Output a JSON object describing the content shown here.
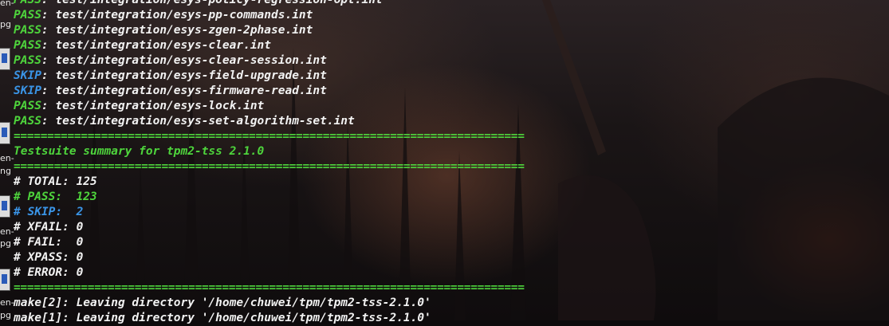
{
  "desktop": {
    "labels": [
      "en-",
      "pg",
      "en-",
      "ng",
      "en-",
      "pg",
      "en-",
      "pg"
    ]
  },
  "terminal": {
    "lines": [
      {
        "status": "PASS",
        "status_color": "green",
        "text": ": test/integration/esys-policy-regression-opt.int"
      },
      {
        "status": "PASS",
        "status_color": "green",
        "text": ": test/integration/esys-pp-commands.int"
      },
      {
        "status": "PASS",
        "status_color": "green",
        "text": ": test/integration/esys-zgen-2phase.int"
      },
      {
        "status": "PASS",
        "status_color": "green",
        "text": ": test/integration/esys-clear.int"
      },
      {
        "status": "PASS",
        "status_color": "green",
        "text": ": test/integration/esys-clear-session.int"
      },
      {
        "status": "SKIP",
        "status_color": "blue",
        "text": ": test/integration/esys-field-upgrade.int"
      },
      {
        "status": "SKIP",
        "status_color": "blue",
        "text": ": test/integration/esys-firmware-read.int"
      },
      {
        "status": "PASS",
        "status_color": "green",
        "text": ": test/integration/esys-lock.int"
      },
      {
        "status": "PASS",
        "status_color": "green",
        "text": ": test/integration/esys-set-algorithm-set.int"
      }
    ],
    "separator": "============================================================================",
    "summary_title": "Testsuite summary for tpm2-tss 2.1.0",
    "totals": [
      {
        "text": "# TOTAL: 125",
        "color": "white"
      },
      {
        "text": "# PASS:  123",
        "color": "green"
      },
      {
        "text": "# SKIP:  2",
        "color": "blue"
      },
      {
        "text": "# XFAIL: 0",
        "color": "white"
      },
      {
        "text": "# FAIL:  0",
        "color": "white"
      },
      {
        "text": "# XPASS: 0",
        "color": "white"
      },
      {
        "text": "# ERROR: 0",
        "color": "white"
      }
    ],
    "make_lines": [
      "make[2]: Leaving directory '/home/chuwei/tpm/tpm2-tss-2.1.0'",
      "make[1]: Leaving directory '/home/chuwei/tpm/tpm2-tss-2.1.0'"
    ]
  },
  "colors": {
    "green": "#4ed43c",
    "blue": "#3a94e6",
    "white": "#f2f2f2"
  }
}
